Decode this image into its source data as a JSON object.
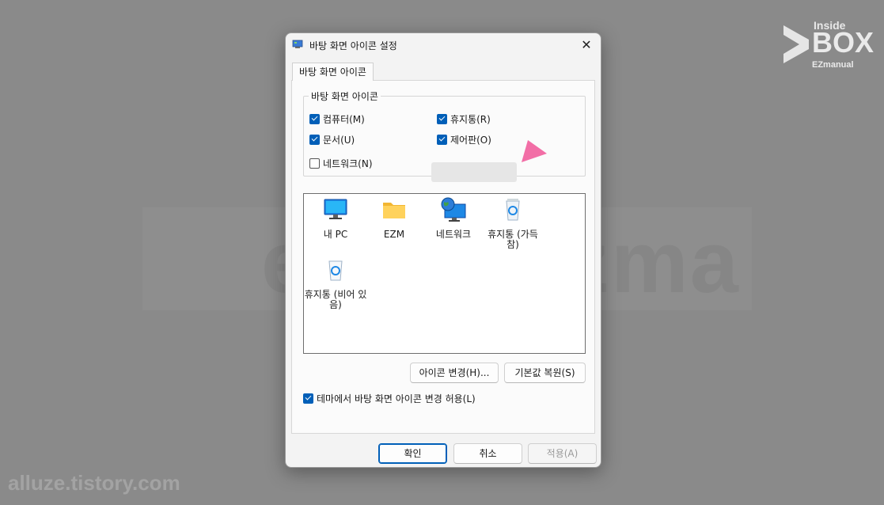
{
  "dialog": {
    "title": "바탕 화면 아이콘 설정",
    "close_label": "✕",
    "tab_label": "바탕 화면 아이콘",
    "group_label": "바탕 화면 아이콘",
    "checkboxes": [
      {
        "label": "컴퓨터(M)",
        "checked": true
      },
      {
        "label": "휴지통(R)",
        "checked": true
      },
      {
        "label": "문서(U)",
        "checked": true
      },
      {
        "label": "제어판(O)",
        "checked": true
      },
      {
        "label": "네트워크(N)",
        "checked": false
      }
    ],
    "icons": [
      {
        "label": "내 PC",
        "icon": "monitor-icon"
      },
      {
        "label": "EZM",
        "icon": "folder-icon"
      },
      {
        "label": "네트워크",
        "icon": "network-globe-icon"
      },
      {
        "label": "휴지통 (가득 참)",
        "icon": "recycle-bin-full-icon"
      },
      {
        "label": "휴지통 (비어 있음)",
        "icon": "recycle-bin-empty-icon"
      }
    ],
    "change_icon_label": "아이콘 변경(H)...",
    "restore_default_label": "기본값 복원(S)",
    "theme_checkbox": {
      "label": "테마에서 바탕 화면 아이콘 변경 허용(L)",
      "checked": true
    },
    "ok_label": "확인",
    "cancel_label": "취소",
    "apply_label": "적용(A)"
  },
  "watermarks": {
    "site": "alluze.tistory.com",
    "background_text": "eBox Ezma",
    "logo": {
      "line1": "Inside",
      "line2": "BOX",
      "line3": "EZmanual"
    }
  },
  "colors": {
    "accent": "#005fb8",
    "pointer_arrow": "#f26ea6"
  }
}
